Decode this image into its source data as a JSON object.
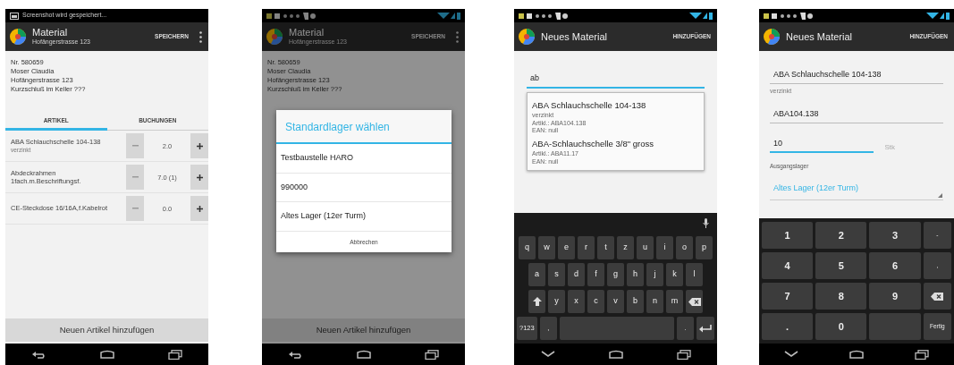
{
  "phones": [
    {
      "kind": "list",
      "status_text": "Screenshot wird gespeichert...",
      "title": "Material",
      "subtitle": "Hofängerstrasse 123",
      "action": "SPEICHERN",
      "overflow_menu": true,
      "keyboard_open": false,
      "info": [
        "Nr. 580659",
        "Moser Claudia",
        "Hofängerstrasse 123",
        "Kurzschluß im Keller ???"
      ],
      "tabs": [
        {
          "label": "ARTIKEL",
          "selected": true
        },
        {
          "label": "BUCHUNGEN",
          "selected": false
        }
      ],
      "items": [
        {
          "name": "ABA Schlauchschelle 104-138",
          "note": "verzinkt",
          "quantity": "2.0"
        },
        {
          "name": "Abdeckrahmen 1fach.m.Beschriftungsf.",
          "quantity": "7.0 (1)"
        },
        {
          "name": "CE-Steckdose 16/16A,f.Kabelrot",
          "quantity": "0.0"
        }
      ],
      "add_button": "Neuen Artikel hinzufügen"
    },
    {
      "kind": "dialog",
      "title": "Material",
      "subtitle": "Hofängerstrasse 123",
      "action": "SPEICHERN",
      "overflow_menu": true,
      "keyboard_open": false,
      "info": [
        "Nr. 580659",
        "Moser Claudia",
        "Hofängerstrasse 123",
        "Kurzschluß im Keller ???"
      ],
      "add_button": "Neuen Artikel hinzufügen",
      "dialog": {
        "title": "Standardlager wählen",
        "options": [
          "Testbaustelle HARO",
          "990000",
          "Altes Lager (12er Turm)"
        ],
        "cancel": "Abbrechen"
      }
    },
    {
      "kind": "search",
      "title": "Neues Material",
      "action": "HINZUFÜGEN",
      "overflow_menu": false,
      "keyboard_open": true,
      "query": "ab",
      "suggestions": [
        {
          "name": "ABA Schlauchschelle 104-138",
          "lines": [
            "verzinkt",
            "Artikl.: ABA104.138",
            "EAN: null"
          ]
        },
        {
          "name": "ABA-Schlauchschelle 3/8\" gross",
          "lines": [
            "Artikl.: ABA11.17",
            "EAN: null"
          ]
        }
      ],
      "keyboard": {
        "rows": [
          [
            {
              "kind": "text",
              "label": "q"
            },
            {
              "kind": "text",
              "label": "w"
            },
            {
              "kind": "text",
              "label": "e"
            },
            {
              "kind": "text",
              "label": "r"
            },
            {
              "kind": "text",
              "label": "t"
            },
            {
              "kind": "text",
              "label": "z"
            },
            {
              "kind": "text",
              "label": "u"
            },
            {
              "kind": "text",
              "label": "i"
            },
            {
              "kind": "text",
              "label": "o"
            },
            {
              "kind": "text",
              "label": "p"
            }
          ],
          [
            {
              "kind": "text",
              "label": "a"
            },
            {
              "kind": "text",
              "label": "s"
            },
            {
              "kind": "text",
              "label": "d"
            },
            {
              "kind": "text",
              "label": "f"
            },
            {
              "kind": "text",
              "label": "g"
            },
            {
              "kind": "text",
              "label": "h"
            },
            {
              "kind": "text",
              "label": "j"
            },
            {
              "kind": "text",
              "label": "k"
            },
            {
              "kind": "text",
              "label": "l"
            }
          ],
          [
            {
              "kind": "shift"
            },
            {
              "kind": "text",
              "label": "y"
            },
            {
              "kind": "text",
              "label": "x"
            },
            {
              "kind": "text",
              "label": "c"
            },
            {
              "kind": "text",
              "label": "v"
            },
            {
              "kind": "text",
              "label": "b"
            },
            {
              "kind": "text",
              "label": "n"
            },
            {
              "kind": "text",
              "label": "m"
            },
            {
              "kind": "backspace"
            }
          ],
          [
            {
              "kind": "text",
              "label": "?123"
            },
            {
              "kind": "text",
              "label": ","
            },
            {
              "kind": "space"
            },
            {
              "kind": "text",
              "label": "."
            },
            {
              "kind": "enter"
            }
          ]
        ]
      }
    },
    {
      "kind": "form",
      "title": "Neues Material",
      "action": "HINZUFÜGEN",
      "overflow_menu": false,
      "keyboard_open": true,
      "fields": [
        {
          "value": "ABA Schlauchschelle 104-138",
          "helper": "verzinkt",
          "focused": false
        },
        {
          "value": "ABA104.138",
          "focused": false
        },
        {
          "value": "10",
          "unit": "Stk",
          "focused": true
        }
      ],
      "storage_label": "Ausgangslager",
      "storage": "Altes Lager (12er Turm)",
      "keyboard": {
        "rows": [
          [
            {
              "kind": "text",
              "label": "1"
            },
            {
              "kind": "text",
              "label": "2"
            },
            {
              "kind": "text",
              "label": "3"
            },
            {
              "kind": "text",
              "label": "-"
            }
          ],
          [
            {
              "kind": "text",
              "label": "4"
            },
            {
              "kind": "text",
              "label": "5"
            },
            {
              "kind": "text",
              "label": "6"
            },
            {
              "kind": "text",
              "label": ","
            }
          ],
          [
            {
              "kind": "text",
              "label": "7"
            },
            {
              "kind": "text",
              "label": "8"
            },
            {
              "kind": "text",
              "label": "9"
            },
            {
              "kind": "backspace"
            }
          ],
          [
            {
              "kind": "text",
              "label": "."
            },
            {
              "kind": "text",
              "label": "0"
            },
            {
              "kind": "space"
            },
            {
              "kind": "text",
              "label": "Fertig"
            }
          ]
        ]
      }
    }
  ]
}
